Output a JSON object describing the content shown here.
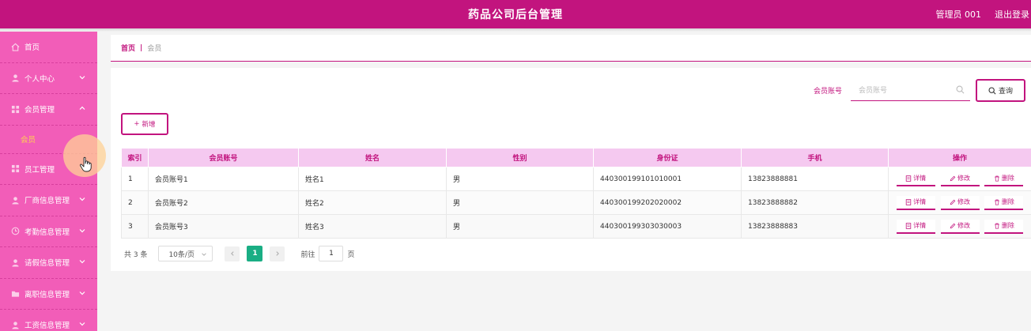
{
  "header": {
    "title": "药品公司后台管理",
    "admin_label": "管理员 001",
    "logout_label": "退出登录"
  },
  "colors": {
    "primary": "#c2147e",
    "sidebar": "#f25db8",
    "active_submenu": "#ffd24f",
    "table_header": "#f5c9f0",
    "page_active": "#1aae84"
  },
  "sidebar": {
    "items": [
      {
        "label": "首页",
        "icon": "home-icon",
        "has_chevron": false
      },
      {
        "label": "个人中心",
        "icon": "user-icon",
        "has_chevron": true
      },
      {
        "label": "会员管理",
        "icon": "grid-icon",
        "has_chevron": true,
        "expanded": true
      },
      {
        "label": "员工管理",
        "icon": "grid-icon",
        "has_chevron": true
      },
      {
        "label": "厂商信息管理",
        "icon": "user-icon",
        "has_chevron": true
      },
      {
        "label": "考勤信息管理",
        "icon": "clock-icon",
        "has_chevron": true
      },
      {
        "label": "请假信息管理",
        "icon": "user-icon",
        "has_chevron": true
      },
      {
        "label": "离职信息管理",
        "icon": "folder-icon",
        "has_chevron": true
      },
      {
        "label": "工资信息管理",
        "icon": "user-icon",
        "has_chevron": true
      }
    ],
    "submenu": {
      "label": "会员"
    }
  },
  "breadcrumb": {
    "home": "首页",
    "separator": "|",
    "current": "会员"
  },
  "search": {
    "label": "会员账号",
    "placeholder": "会员账号",
    "value": "",
    "button_label": "查询"
  },
  "toolbar": {
    "add_label": "新增"
  },
  "table": {
    "columns": [
      "索引",
      "会员账号",
      "姓名",
      "性别",
      "身份证",
      "手机",
      "操作"
    ],
    "rows": [
      {
        "index": "1",
        "account": "会员账号1",
        "name": "姓名1",
        "gender": "男",
        "id_card": "440300199101010001",
        "phone": "13823888881"
      },
      {
        "index": "2",
        "account": "会员账号2",
        "name": "姓名2",
        "gender": "男",
        "id_card": "440300199202020002",
        "phone": "13823888882"
      },
      {
        "index": "3",
        "account": "会员账号3",
        "name": "姓名3",
        "gender": "男",
        "id_card": "440300199303030003",
        "phone": "13823888883"
      }
    ],
    "actions": {
      "detail": "详情",
      "edit": "修改",
      "delete": "删除"
    }
  },
  "pagination": {
    "total_text": "共 3 条",
    "page_size": "10条/页",
    "current_page": "1",
    "goto_label": "前往",
    "goto_value": "1",
    "page_suffix": "页"
  }
}
